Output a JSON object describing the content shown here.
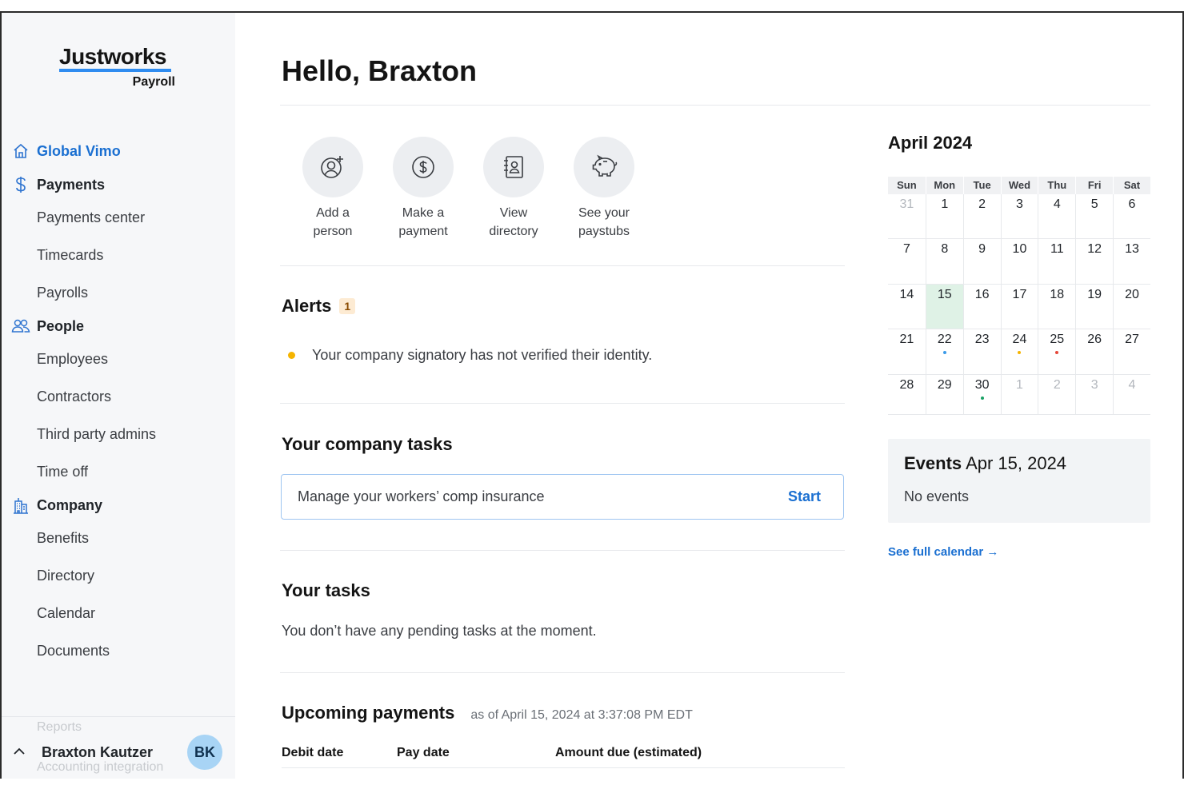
{
  "brand": {
    "name": "Justworks",
    "product": "Payroll"
  },
  "sidebar": {
    "org": "Global Vimo",
    "sections": [
      {
        "label": "Payments",
        "items": [
          "Payments center",
          "Timecards",
          "Payrolls"
        ]
      },
      {
        "label": "People",
        "items": [
          "Employees",
          "Contractors",
          "Third party admins",
          "Time off"
        ]
      },
      {
        "label": "Company",
        "items": [
          "Benefits",
          "Directory",
          "Calendar",
          "Documents"
        ]
      }
    ],
    "ghost_items": [
      "Reports",
      "Accounting integration"
    ],
    "user": {
      "name": "Braxton Kautzer",
      "initials": "BK"
    }
  },
  "main": {
    "greeting": "Hello, Braxton",
    "quick_actions": [
      {
        "line1": "Add a",
        "line2": "person",
        "icon": "add-person-icon"
      },
      {
        "line1": "Make a",
        "line2": "payment",
        "icon": "dollar-icon"
      },
      {
        "line1": "View",
        "line2": "directory",
        "icon": "contact-book-icon"
      },
      {
        "line1": "See your",
        "line2": "paystubs",
        "icon": "piggy-bank-icon"
      }
    ],
    "alerts": {
      "title": "Alerts",
      "count": "1",
      "items": [
        "Your company signatory has not verified their identity."
      ]
    },
    "company_tasks": {
      "title": "Your company tasks",
      "task": "Manage your workers’ comp insurance",
      "action": "Start"
    },
    "your_tasks": {
      "title": "Your tasks",
      "empty": "You don’t have any pending tasks at the moment."
    },
    "upcoming": {
      "title": "Upcoming payments",
      "as_of": "as of April 15, 2024 at 3:37:08 PM EDT",
      "columns": [
        "Debit date",
        "Pay date",
        "Amount due (estimated)"
      ]
    }
  },
  "calendar": {
    "title": "April 2024",
    "weekdays": [
      "Sun",
      "Mon",
      "Tue",
      "Wed",
      "Thu",
      "Fri",
      "Sat"
    ],
    "weeks": [
      [
        "31",
        "1",
        "2",
        "3",
        "4",
        "5",
        "6"
      ],
      [
        "7",
        "8",
        "9",
        "10",
        "11",
        "12",
        "13"
      ],
      [
        "14",
        "15",
        "16",
        "17",
        "18",
        "19",
        "20"
      ],
      [
        "21",
        "22",
        "23",
        "24",
        "25",
        "26",
        "27"
      ],
      [
        "28",
        "29",
        "30",
        "1",
        "2",
        "3",
        "4"
      ]
    ],
    "today": "15",
    "event_markers": [
      {
        "day": "22",
        "color": "#3b9ae8"
      },
      {
        "day": "24",
        "color": "#f5b400"
      },
      {
        "day": "25",
        "color": "#e5483a"
      },
      {
        "day": "30",
        "color": "#1aa265"
      }
    ],
    "events_label": "Events",
    "events_date": "Apr 15, 2024",
    "events_empty": "No events",
    "full_link": "See full calendar →"
  },
  "colors": {
    "accent": "#1a6fd1",
    "today_bg": "#dff2e6",
    "alert_dot": "#f5b400"
  }
}
